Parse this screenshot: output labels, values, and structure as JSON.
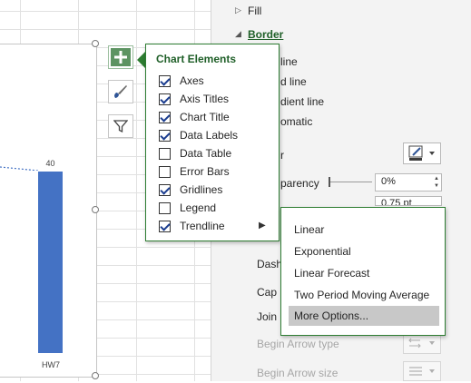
{
  "chart": {
    "bar_value_label": "40",
    "category_label": "HW7",
    "bar_color": "#4472c4"
  },
  "side_buttons": {
    "elements_icon": "plus-icon",
    "styles_icon": "paintbrush-icon",
    "filters_icon": "funnel-icon"
  },
  "chart_elements": {
    "title": "Chart Elements",
    "items": [
      {
        "label": "Axes",
        "checked": true
      },
      {
        "label": "Axis Titles",
        "checked": true
      },
      {
        "label": "Chart Title",
        "checked": true
      },
      {
        "label": "Data Labels",
        "checked": true
      },
      {
        "label": "Data Table",
        "checked": false
      },
      {
        "label": "Error Bars",
        "checked": false
      },
      {
        "label": "Gridlines",
        "checked": true
      },
      {
        "label": "Legend",
        "checked": false
      },
      {
        "label": "Trendline",
        "checked": true
      }
    ]
  },
  "trendline_menu": {
    "items": [
      "Linear",
      "Exponential",
      "Linear Forecast",
      "Two Period Moving Average",
      "More Options..."
    ],
    "highlighted": "More Options..."
  },
  "format_pane": {
    "fill_label": "Fill",
    "border_label": "Border",
    "options_partial": [
      "line",
      "d line",
      "dient line",
      "omatic"
    ],
    "color_label_partial": "r",
    "transparency_label": "parency",
    "transparency_value": "0%",
    "width_value": "0.75 pt",
    "dash_label": "Dash",
    "cap_label": "Cap",
    "join_label": "Join",
    "begin_arrow_type_label": "Begin Arrow type",
    "begin_arrow_size_label": "Begin Arrow size"
  },
  "colors": {
    "accent_green": "#2e7d32",
    "highlight_gray": "#c8c8c8"
  }
}
